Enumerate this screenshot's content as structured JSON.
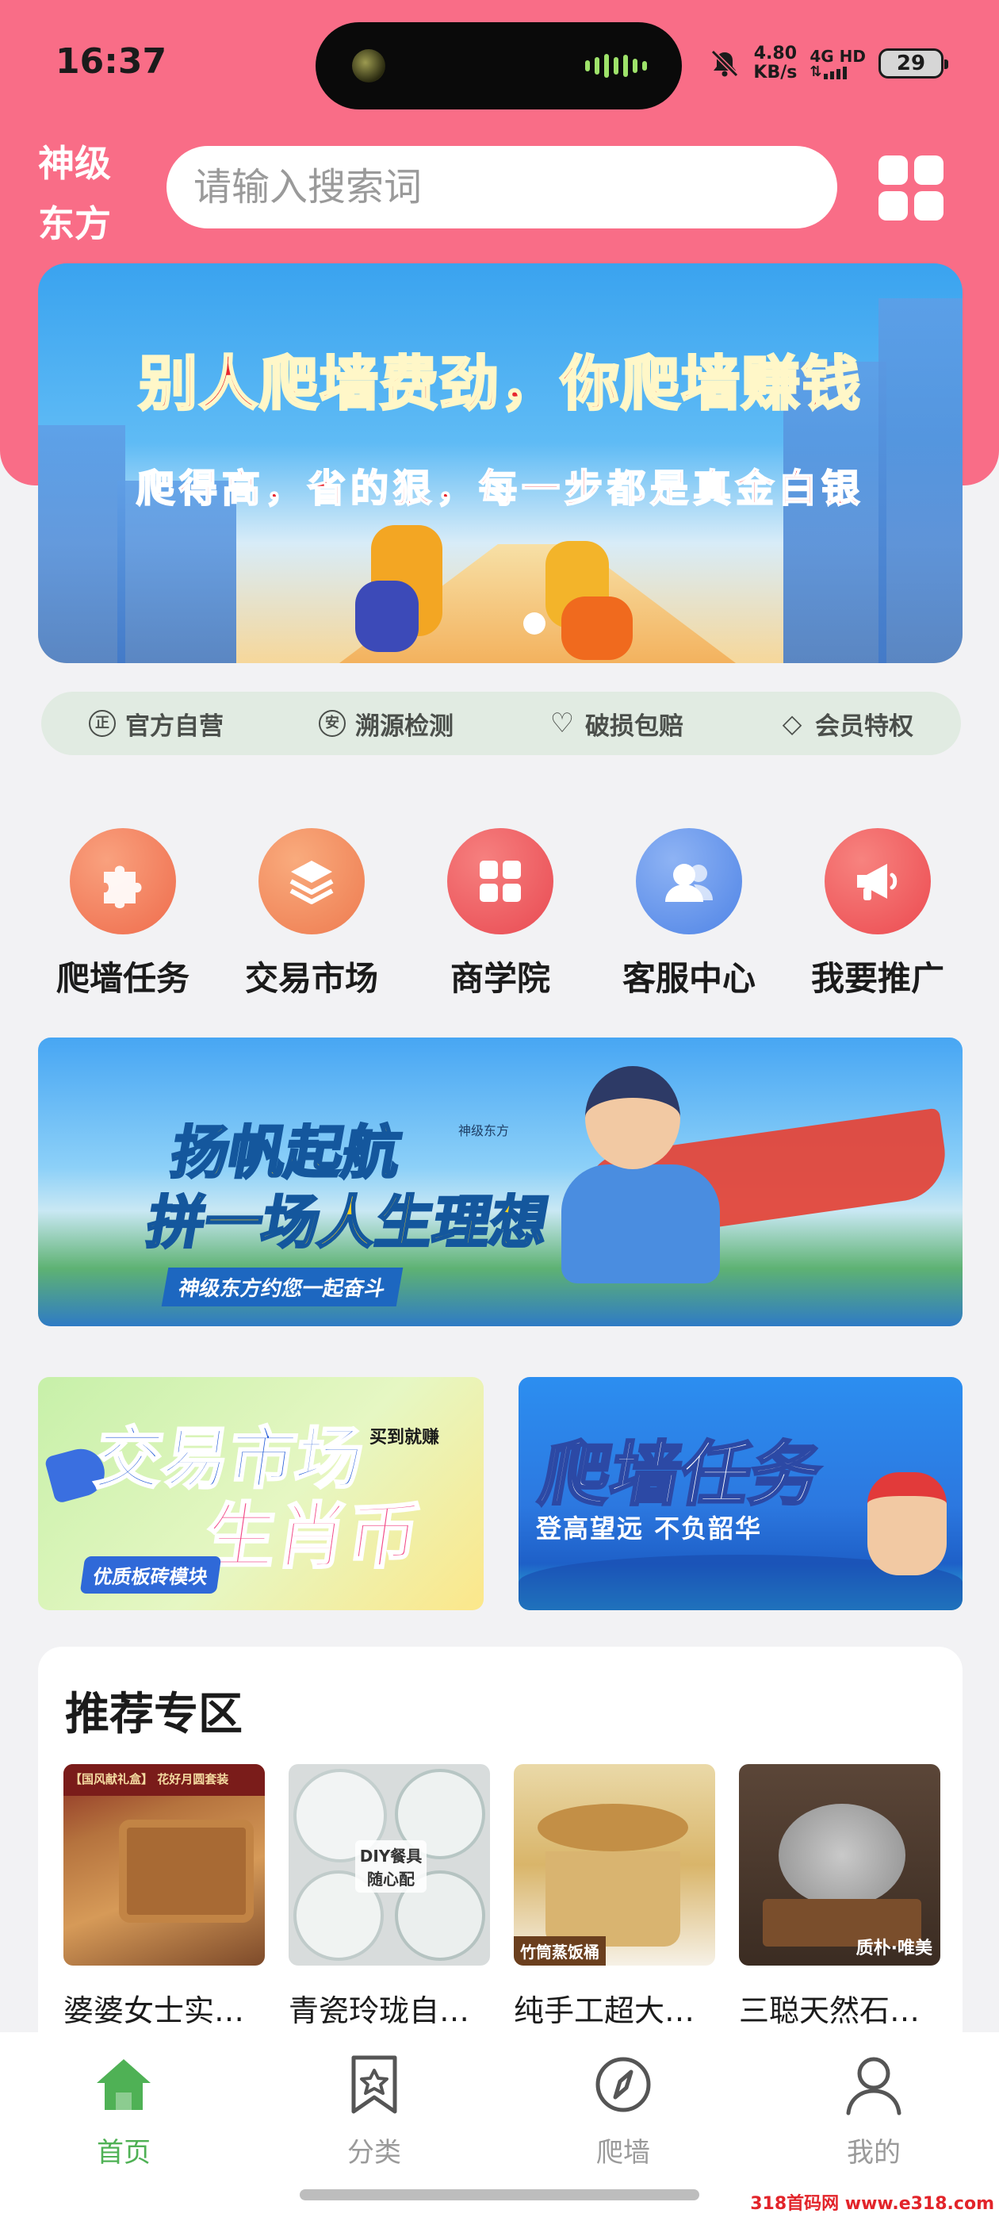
{
  "status_bar": {
    "time": "16:37",
    "speed_value": "4.80",
    "speed_unit": "KB/s",
    "network_type": "4G HD",
    "battery": "29"
  },
  "header": {
    "brand": "神级东方",
    "search_placeholder": "请输入搜索词",
    "grid_icon": "grid-menu-icon",
    "background_color": "#f96d87"
  },
  "hero_banner": {
    "title": "别人爬墙费劲，你爬墙赚钱",
    "subtitle": "爬得高，省的狠，每一步都是真金白银"
  },
  "trust_bar": {
    "items": [
      {
        "icon": "正",
        "label": "官方自营"
      },
      {
        "icon": "安",
        "label": "溯源检测"
      },
      {
        "icon": "♡",
        "label": "破损包赔"
      },
      {
        "icon": "◇",
        "label": "会员特权"
      }
    ]
  },
  "quick_menu": {
    "items": [
      {
        "label": "爬墙任务",
        "icon": "puzzle-icon",
        "color": "#f07a57"
      },
      {
        "label": "交易市场",
        "icon": "layers-icon",
        "color": "#f08a5c"
      },
      {
        "label": "商学院",
        "icon": "grid-icon",
        "color": "#ee5a5f"
      },
      {
        "label": "客服中心",
        "icon": "people-icon",
        "color": "#5b8fe8"
      },
      {
        "label": "我要推广",
        "icon": "megaphone-icon",
        "color": "#f05a5d"
      }
    ]
  },
  "promo_banner": {
    "line1": "扬帆起航",
    "line2": "拼一场人生理想",
    "tag": "神级东方约您一起奋斗",
    "small_text": "神级东方"
  },
  "cards": {
    "market": {
      "line1": "交易市场",
      "line2": "生肖币",
      "corner": "买到就赚",
      "tag": "优质板砖模块"
    },
    "climb": {
      "title": "爬墙任务",
      "subtitle": "登高望远  不负韶华"
    }
  },
  "recommend": {
    "title": "推荐专区",
    "products": [
      {
        "name": "婆婆女士实木礼盒套装",
        "caption": "【国风献礼盒】 花好月圆套装"
      },
      {
        "name": "青瓷玲珑自选餐具套装",
        "caption": "DIY餐具 随心配"
      },
      {
        "name": "纯手工超大竹筒蒸饭桶",
        "caption": "竹筒蒸饭桶"
      },
      {
        "name": "三聪天然石锅套装",
        "caption": "质朴·唯美"
      }
    ]
  },
  "tab_bar": {
    "tabs": [
      {
        "label": "首页",
        "icon": "home-icon",
        "active": true
      },
      {
        "label": "分类",
        "icon": "bookmark-star-icon",
        "active": false
      },
      {
        "label": "爬墙",
        "icon": "compass-icon",
        "active": false
      },
      {
        "label": "我的",
        "icon": "user-icon",
        "active": false
      }
    ],
    "active_color": "#4fb155"
  },
  "watermark": "318首码网 www.e318.com"
}
